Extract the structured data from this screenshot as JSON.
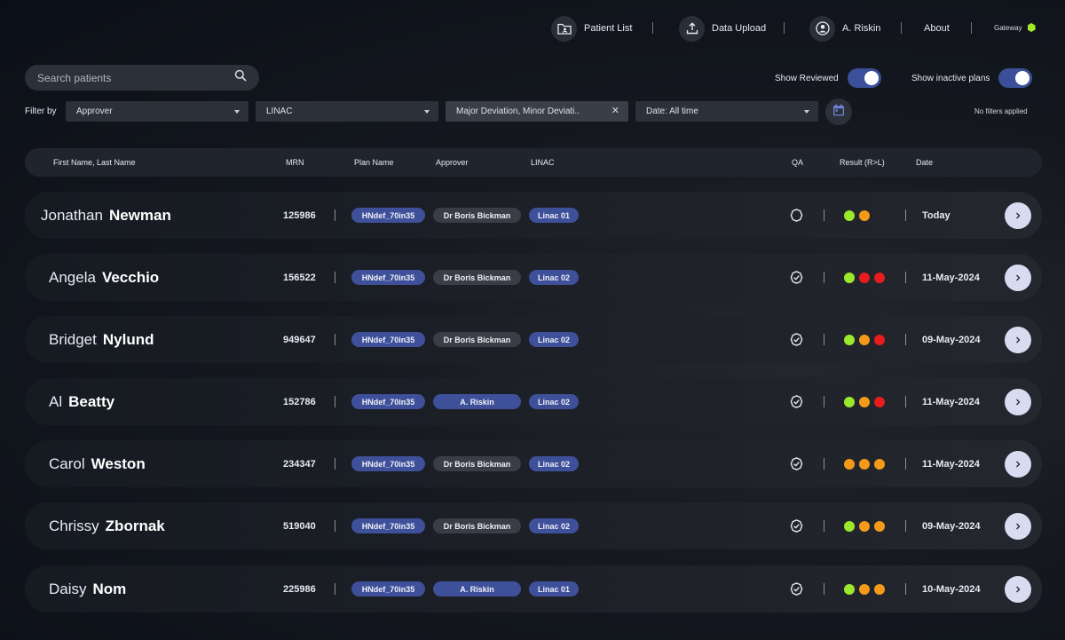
{
  "nav": {
    "patient_list": "Patient List",
    "data_upload": "Data Upload",
    "user": "A. Riskin",
    "about": "About",
    "gateway": "Gateway",
    "gateway_status_color": "#a5e82b"
  },
  "search": {
    "placeholder": "Search patients"
  },
  "toggles": {
    "show_reviewed": {
      "label": "Show Reviewed",
      "on": true
    },
    "show_inactive": {
      "label": "Show inactive plans",
      "on": true
    }
  },
  "filters": {
    "label": "Filter by",
    "approver": "Approver",
    "linac": "LINAC",
    "result": "Major Deviation, Minor Deviati..",
    "date": "Date: All time",
    "status": "No filters applied"
  },
  "table": {
    "headers": {
      "name": "First Name,  Last Name",
      "mrn": "MRN",
      "plan": "Plan Name",
      "approver": "Approver",
      "linac": "LINAC",
      "qa": "QA",
      "result": "Result (R>L)",
      "date": "Date"
    },
    "rows": [
      {
        "first": "Jonathan",
        "last": "Newman",
        "mrn": "125986",
        "plan": "HNdef_70in35",
        "approver": "Dr Boris Bickman",
        "approver_blue": false,
        "linac": "Linac 01",
        "qa": "pending",
        "results": [
          "green",
          "orange"
        ],
        "date": "Today"
      },
      {
        "first": "Angela",
        "last": "Vecchio",
        "mrn": "156522",
        "plan": "HNdef_70in35",
        "approver": "Dr Boris Bickman",
        "approver_blue": false,
        "linac": "Linac 02",
        "qa": "verified",
        "results": [
          "green",
          "red",
          "red"
        ],
        "date": "11-May-2024"
      },
      {
        "first": "Bridget",
        "last": "Nylund",
        "mrn": "949647",
        "plan": "HNdef_70in35",
        "approver": "Dr Boris Bickman",
        "approver_blue": false,
        "linac": "Linac 02",
        "qa": "verified",
        "results": [
          "green",
          "orange",
          "red"
        ],
        "date": "09-May-2024"
      },
      {
        "first": "Al",
        "last": "Beatty",
        "mrn": "152786",
        "plan": "HNdef_70in35",
        "approver": "A. Riskin",
        "approver_blue": true,
        "linac": "Linac 02",
        "qa": "verified",
        "results": [
          "green",
          "orange",
          "red"
        ],
        "date": "11-May-2024"
      },
      {
        "first": "Carol",
        "last": "Weston",
        "mrn": "234347",
        "plan": "HNdef_70in35",
        "approver": "Dr Boris Bickman",
        "approver_blue": false,
        "linac": "Linac 02",
        "qa": "verified",
        "results": [
          "orange",
          "orange",
          "orange"
        ],
        "date": "11-May-2024"
      },
      {
        "first": "Chrissy",
        "last": "Zbornak",
        "mrn": "519040",
        "plan": "HNdef_70in35",
        "approver": "Dr Boris Bickman",
        "approver_blue": false,
        "linac": "Linac 02",
        "qa": "verified",
        "results": [
          "green",
          "orange",
          "orange"
        ],
        "date": "09-May-2024"
      },
      {
        "first": "Daisy",
        "last": "Nom",
        "mrn": "225986",
        "plan": "HNdef_70in35",
        "approver": "A. Riskin",
        "approver_blue": true,
        "linac": "Linac 01",
        "qa": "verified",
        "results": [
          "green",
          "orange",
          "orange"
        ],
        "date": "10-May-2024"
      }
    ]
  },
  "colors": {
    "green": "#9be82c",
    "orange": "#f39a1a",
    "red": "#e81c1c",
    "accent": "#3f509a"
  }
}
